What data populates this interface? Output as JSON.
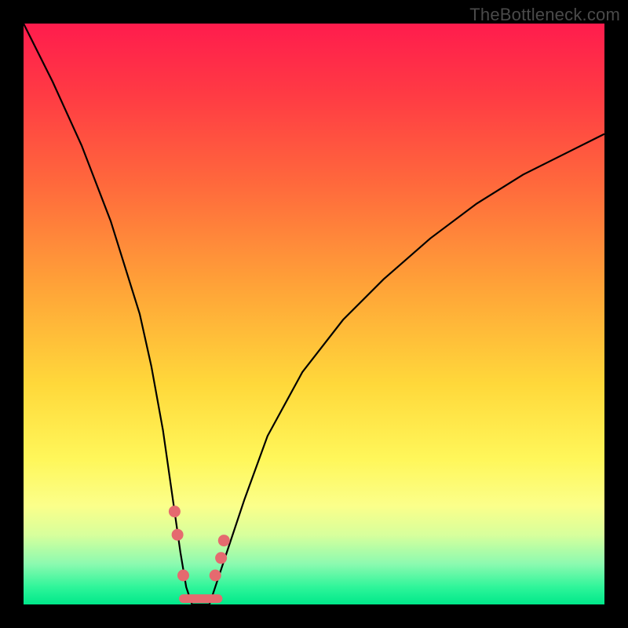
{
  "attribution": "TheBottleneck.com",
  "colors": {
    "dot": "#e56a6f",
    "curve": "#000000"
  },
  "chart_data": {
    "type": "line",
    "title": "",
    "xlabel": "",
    "ylabel": "",
    "xlim": [
      0,
      100
    ],
    "ylim": [
      0,
      100
    ],
    "series": [
      {
        "name": "bottleneck-curve",
        "x": [
          0,
          5,
          10,
          15,
          20,
          22,
          24,
          26,
          27,
          28,
          29,
          30,
          31,
          32,
          33,
          35,
          38,
          42,
          48,
          55,
          62,
          70,
          78,
          86,
          94,
          100
        ],
        "y": [
          100,
          90,
          79,
          66,
          50,
          41,
          30,
          16,
          9,
          3,
          0,
          0,
          0,
          0,
          3,
          9,
          18,
          29,
          40,
          49,
          56,
          63,
          69,
          74,
          78,
          81
        ]
      }
    ],
    "markers": [
      {
        "x": 26.0,
        "y": 16
      },
      {
        "x": 26.5,
        "y": 12
      },
      {
        "x": 27.5,
        "y": 5
      },
      {
        "x": 33.0,
        "y": 5
      },
      {
        "x": 34.0,
        "y": 8
      },
      {
        "x": 34.5,
        "y": 11
      }
    ],
    "floor_segment": {
      "x0": 27.5,
      "x1": 33.5,
      "y": 1
    }
  }
}
